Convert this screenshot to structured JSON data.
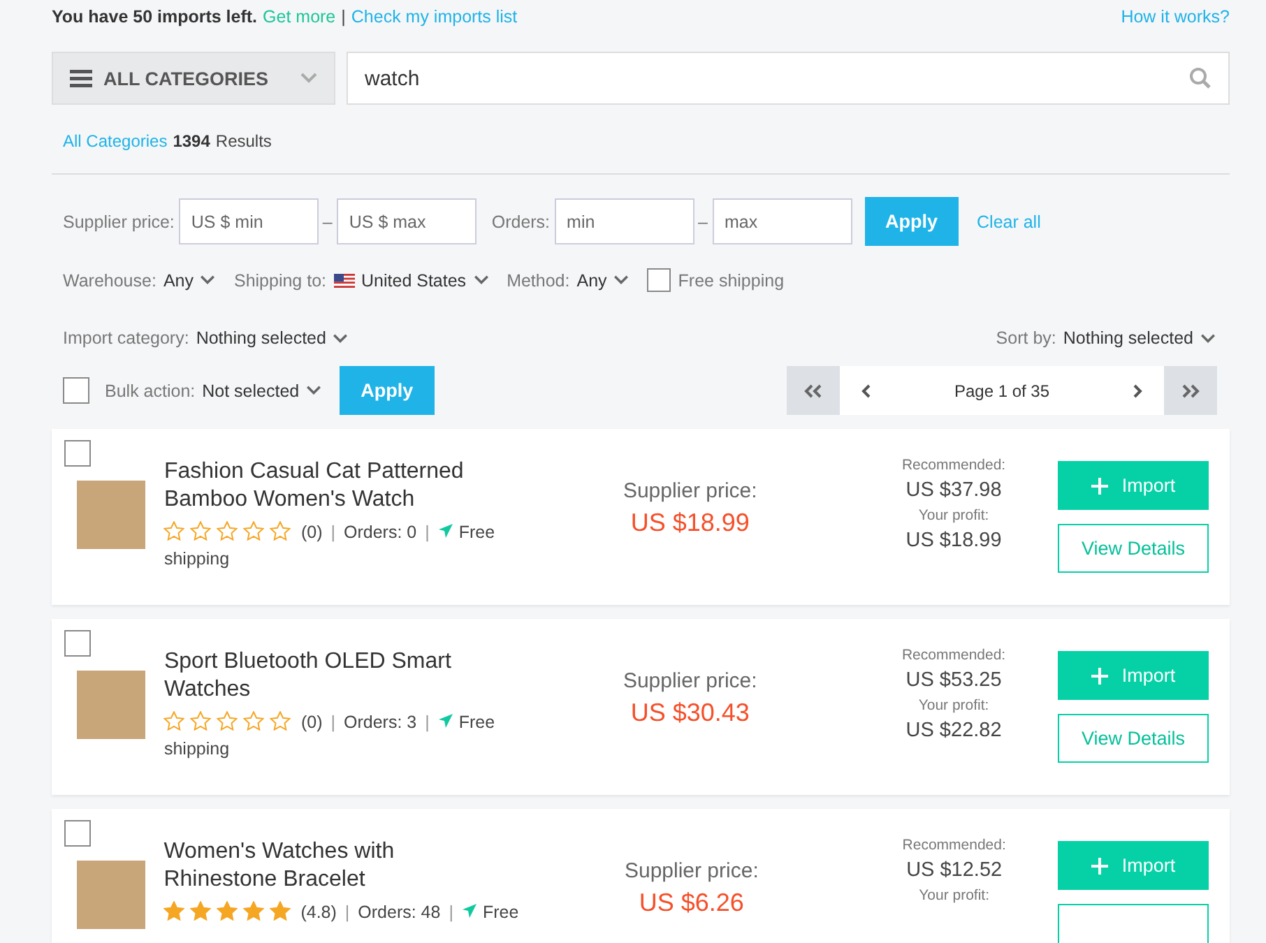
{
  "top_bar": {
    "notice": "You have 50 imports left.",
    "get_more": "Get more",
    "separator": "|",
    "imports_list": "Check my imports list",
    "help": "How it works?"
  },
  "search": {
    "category": "ALL CATEGORIES",
    "value": "watch"
  },
  "results": {
    "category": "All Categories",
    "count": "1394",
    "label": "Results"
  },
  "filters": {
    "supplier_price_label": "Supplier price:",
    "min_placeholder": "US $ min",
    "dash_1": "–",
    "max_placeholder": "US $ max",
    "orders_label": "Orders:",
    "orders_min_placeholder": "min",
    "dash_2": "–",
    "orders_max_placeholder": "max",
    "apply": "Apply",
    "clear": "Clear all",
    "warehouse_label": "Warehouse:",
    "warehouse": "Any",
    "shipping_label": "Shipping to:",
    "shipping": "United States",
    "method_label": "Method:",
    "method": "Any",
    "free_shipping": {
      "label": "Free shipping",
      "checked": false
    },
    "import_category_label": "Import category:",
    "import_category": "Nothing selected",
    "sort_label": "Sort by:",
    "sort": "Nothing selected"
  },
  "bulk": {
    "checked": false,
    "label": "Bulk action:",
    "value": "Not selected",
    "apply": "Apply"
  },
  "pagination": {
    "label": "Page 1 of 35"
  },
  "products": [
    {
      "checked": false,
      "title": "Fashion Casual Cat Patterned Bamboo Women's Watch",
      "stars": 0,
      "rating": "(0)",
      "sep_1": "|",
      "orders": "Orders: 0",
      "sep_2": "|",
      "shipping": "Free",
      "shipping_line_2": "shipping",
      "price_label": "Supplier price:",
      "price": "US $18.99",
      "recommended_label": "Recommended:",
      "recommended": "US $37.98",
      "profit_label": "Your profit:",
      "profit": "US $18.99",
      "import": "Import",
      "details": "View Details"
    },
    {
      "checked": false,
      "title": "Sport Bluetooth OLED Smart Watches",
      "stars": 0,
      "rating": "(0)",
      "sep_1": "|",
      "orders": "Orders: 3",
      "sep_2": "|",
      "shipping": "Free",
      "shipping_line_2": "shipping",
      "price_label": "Supplier price:",
      "price": "US $30.43",
      "recommended_label": "Recommended:",
      "recommended": "US $53.25",
      "profit_label": "Your profit:",
      "profit": "US $22.82",
      "import": "Import",
      "details": "View Details"
    },
    {
      "checked": false,
      "title": "Women's Watches with Rhinestone Bracelet",
      "stars": 5,
      "rating": "(4.8)",
      "sep_1": "|",
      "orders": "Orders: 48",
      "sep_2": "|",
      "shipping": "Free",
      "price_label": "Supplier price:",
      "price": "US $6.26",
      "recommended_label": "Recommended:",
      "recommended": "US $12.52",
      "profit_label": "Your profit:",
      "import": "Import"
    }
  ]
}
